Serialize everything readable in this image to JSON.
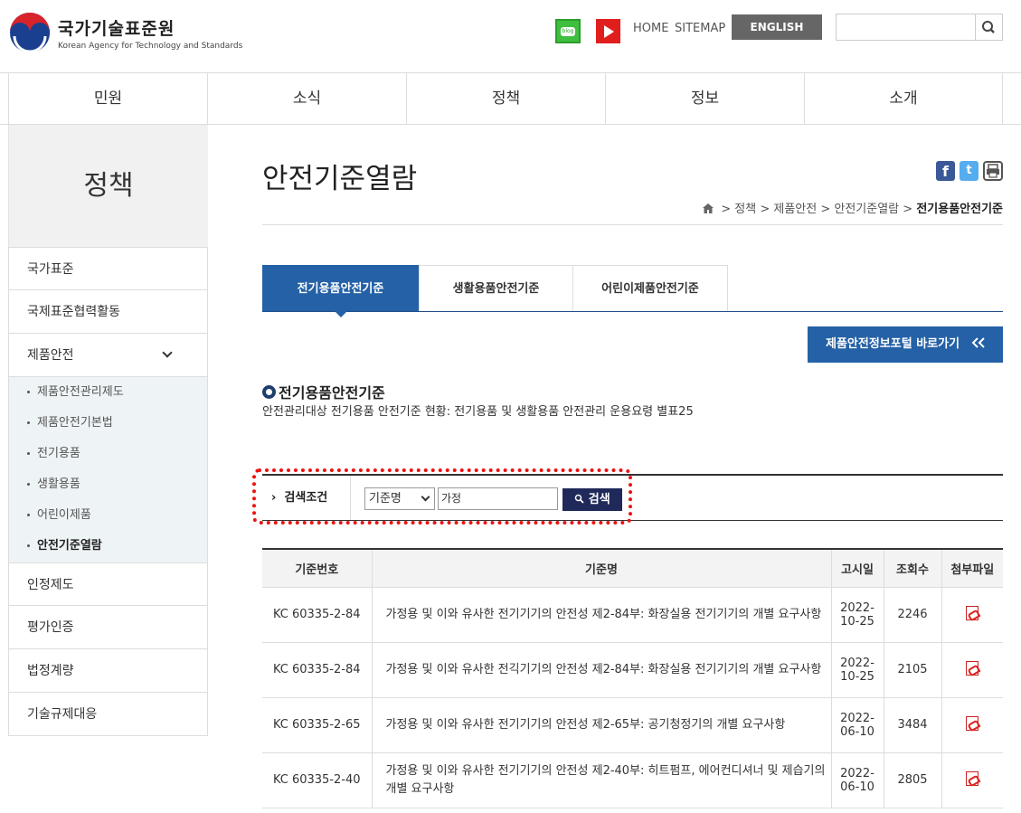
{
  "header": {
    "logo_ko": "국가기술표준원",
    "logo_en": "Korean Agency for Technology and Standards",
    "links": [
      "HOME",
      "SITEMAP"
    ],
    "english_button": "ENGLISH",
    "search_placeholder": ""
  },
  "gnb": [
    "민원",
    "소식",
    "정책",
    "정보",
    "소개"
  ],
  "sidebar": {
    "title": "정책",
    "items_top": [
      "국가표준",
      "국제표준협력활동"
    ],
    "expanded_item": "제품안전",
    "sub_items": [
      "제품안전관리제도",
      "제품안전기본법",
      "전기용품",
      "생활용품",
      "어린이제품",
      "안전기준열람"
    ],
    "active_sub": "안전기준열람",
    "items_bottom": [
      "인정제도",
      "평가인증",
      "법정계량",
      "기술규제대응"
    ]
  },
  "content": {
    "page_title": "안전기준열람",
    "breadcrumb": [
      "정책",
      "제품안전",
      "안전기준열람",
      "전기용품안전기준"
    ],
    "tabs": [
      "전기용품안전기준",
      "생활용품안전기준",
      "어린이제품안전기준"
    ],
    "active_tab": "전기용품안전기준",
    "portal_button": "제품안전정보포털 바로가기",
    "section_title": "전기용품안전기준",
    "section_desc": "안전관리대상 전기용품 안전기준 현황: 전기용품 및 생활용품 안전관리 운용요령 별표25",
    "search": {
      "label": "검색조건",
      "select_value": "기준명",
      "input_value": "가정",
      "button": "검색"
    },
    "table": {
      "headers": [
        "기준번호",
        "기준명",
        "고시일",
        "조회수",
        "첨부파일"
      ],
      "rows": [
        {
          "no": "KC 60335-2-84",
          "name": "가정용 및 이와 유사한 전기기기의 안전성 제2-84부: 화장실용 전기기기의 개별 요구사항",
          "date": "2022-10-25",
          "views": "2246"
        },
        {
          "no": "KC 60335-2-84",
          "name": "가정용 및 이와 유사한 전긱기기의 안전성 제2-84부: 화장실용 전기기기의 개별 요구사항",
          "date": "2022-10-25",
          "views": "2105"
        },
        {
          "no": "KC 60335-2-65",
          "name": "가정용 및 이와 유사한 전기기기의 안전성 제2-65부: 공기청정기의 개별 요구사항",
          "date": "2022-06-10",
          "views": "3484"
        },
        {
          "no": "KC 60335-2-40",
          "name": "가정용 및 이와 유사한 전기기기의 안전성 제2-40부: 히트펌프, 에어컨디셔너 및 제습기의 개별 요구사항",
          "date": "2022-06-10",
          "views": "2805"
        }
      ]
    }
  }
}
